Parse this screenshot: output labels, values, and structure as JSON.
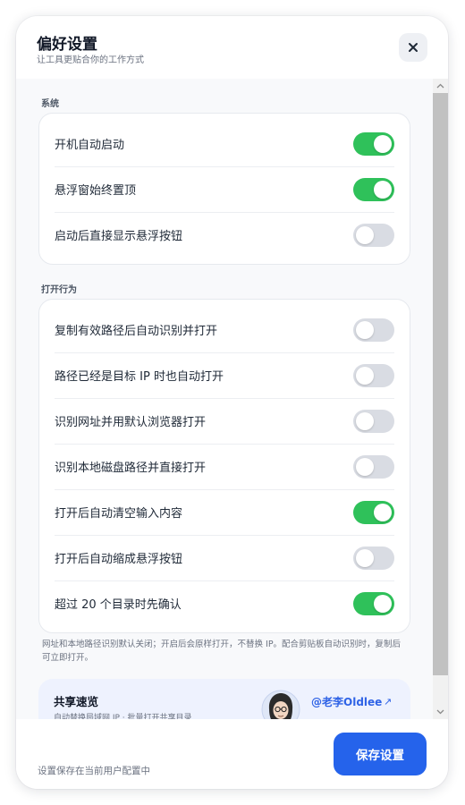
{
  "dialog": {
    "title": "偏好设置",
    "subtitle": "让工具更贴合你的工作方式",
    "close_icon": "close-icon"
  },
  "system": {
    "label": "系统",
    "items": [
      {
        "label": "开机自动启动",
        "on": true
      },
      {
        "label": "悬浮窗始终置顶",
        "on": true
      },
      {
        "label": "启动后直接显示悬浮按钮",
        "on": false
      }
    ]
  },
  "open_behavior": {
    "label": "打开行为",
    "items": [
      {
        "label": "复制有效路径后自动识别并打开",
        "on": false
      },
      {
        "label": "路径已经是目标 IP 时也自动打开",
        "on": false
      },
      {
        "label": "识别网址并用默认浏览器打开",
        "on": false
      },
      {
        "label": "识别本地磁盘路径并直接打开",
        "on": false
      },
      {
        "label": "打开后自动清空输入内容",
        "on": true
      },
      {
        "label": "打开后自动缩成悬浮按钮",
        "on": false
      },
      {
        "label": "超过 20 个目录时先确认",
        "on": true
      }
    ],
    "note": "网址和本地路径识别默认关闭；开启后会原样打开，不替换 IP。配合剪贴板自动识别时，复制后可立即打开。"
  },
  "share": {
    "title": "共享速览",
    "subtitle": "自动替换局域网 IP · 批量打开共享目录",
    "author": "@老李Oldlee",
    "link_icon": "external-link-icon"
  },
  "footer": {
    "text": "设置保存在当前用户配置中",
    "save_label": "保存设置"
  },
  "colors": {
    "toggle_on": "#2fc15a",
    "toggle_off": "#d9dce3",
    "primary": "#2563eb"
  }
}
